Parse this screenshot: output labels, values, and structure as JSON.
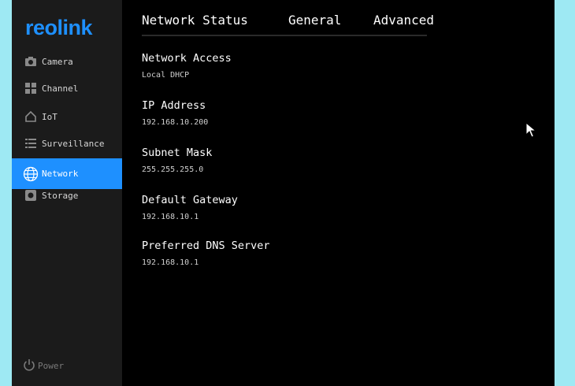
{
  "app": {
    "logo_text": "reolink",
    "accent_color": "#1e90ff"
  },
  "sidebar": {
    "items": [
      {
        "label": "Camera",
        "icon": "camera-icon"
      },
      {
        "label": "Channel",
        "icon": "channel-grid-icon"
      },
      {
        "label": "IoT",
        "icon": "home-iot-icon"
      },
      {
        "label": "Surveillance",
        "icon": "list-icon"
      },
      {
        "label": "Network",
        "icon": "globe-icon",
        "active": true
      },
      {
        "label": "Storage",
        "icon": "storage-disk-icon"
      }
    ],
    "power_label": "Power"
  },
  "tabs": [
    {
      "label": "Network Status",
      "active": true
    },
    {
      "label": "General"
    },
    {
      "label": "Advanced"
    }
  ],
  "fields": [
    {
      "label": "Network Access",
      "value": "Local DHCP"
    },
    {
      "label": "IP Address",
      "value": "192.168.10.200"
    },
    {
      "label": "Subnet Mask",
      "value": "255.255.255.0"
    },
    {
      "label": "Default Gateway",
      "value": "192.168.10.1"
    },
    {
      "label": "Preferred DNS Server",
      "value": "192.168.10.1"
    }
  ]
}
